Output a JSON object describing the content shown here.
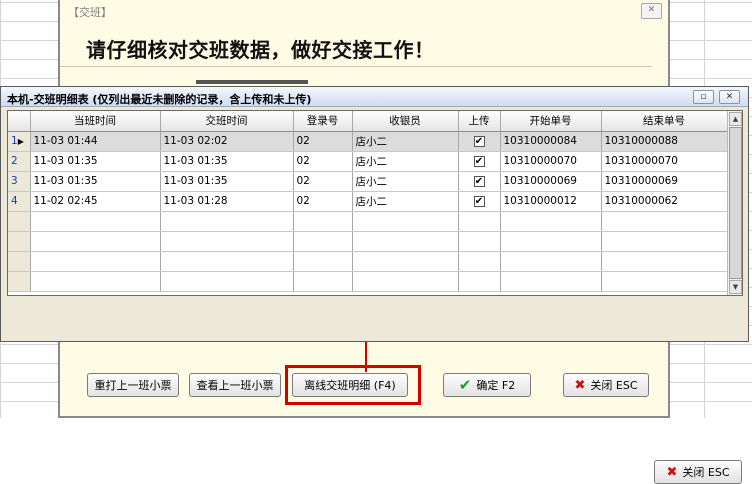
{
  "shift_dialog": {
    "title": "【交班】",
    "headline": "请仔细核对交班数据，做好交接工作！",
    "close_glyph": "✕",
    "buttons": {
      "reprint": "重打上一班小票",
      "view": "查看上一班小票",
      "offline_detail": "离线交班明细 (F4)",
      "confirm": "确定 F2",
      "close": "关闭 ESC"
    }
  },
  "detail_window": {
    "title": "本机-交班明细表 (仅列出最近未删除的记录，含上传和未上传)",
    "restore_glyph": "▫",
    "close_glyph": "✕",
    "close_button": "关闭 ESC",
    "columns": [
      "当班时间",
      "交班时间",
      "登录号",
      "收银员",
      "上传",
      "开始单号",
      "结束单号"
    ],
    "rows": [
      {
        "index": "1",
        "on_duty": "11-03    01:44",
        "shift": "11-03    02:02",
        "login": "02",
        "cashier": "店小二",
        "uploaded": true,
        "start_no": "10310000084",
        "end_no": "10310000088"
      },
      {
        "index": "2",
        "on_duty": "11-03    01:35",
        "shift": "11-03    01:35",
        "login": "02",
        "cashier": "店小二",
        "uploaded": true,
        "start_no": "10310000070",
        "end_no": "10310000070"
      },
      {
        "index": "3",
        "on_duty": "11-03    01:35",
        "shift": "11-03    01:35",
        "login": "02",
        "cashier": "店小二",
        "uploaded": true,
        "start_no": "10310000069",
        "end_no": "10310000069"
      },
      {
        "index": "4",
        "on_duty": "11-02    02:45",
        "shift": "11-03    01:28",
        "login": "02",
        "cashier": "店小二",
        "uploaded": true,
        "start_no": "10310000012",
        "end_no": "10310000062"
      }
    ]
  },
  "icons": {
    "check_glyph": "✔",
    "close_x_glyph": "✖",
    "row_pointer_glyph": "▶",
    "scroll_up_glyph": "▲",
    "scroll_down_glyph": "▼"
  },
  "colors": {
    "highlight": "#d40000",
    "dialog_bg": "#fffce6",
    "window_bg": "#ece9d8",
    "row_index": "#1a3ea8",
    "confirm_icon": "#1f9a2e",
    "close_icon": "#cc1111"
  }
}
